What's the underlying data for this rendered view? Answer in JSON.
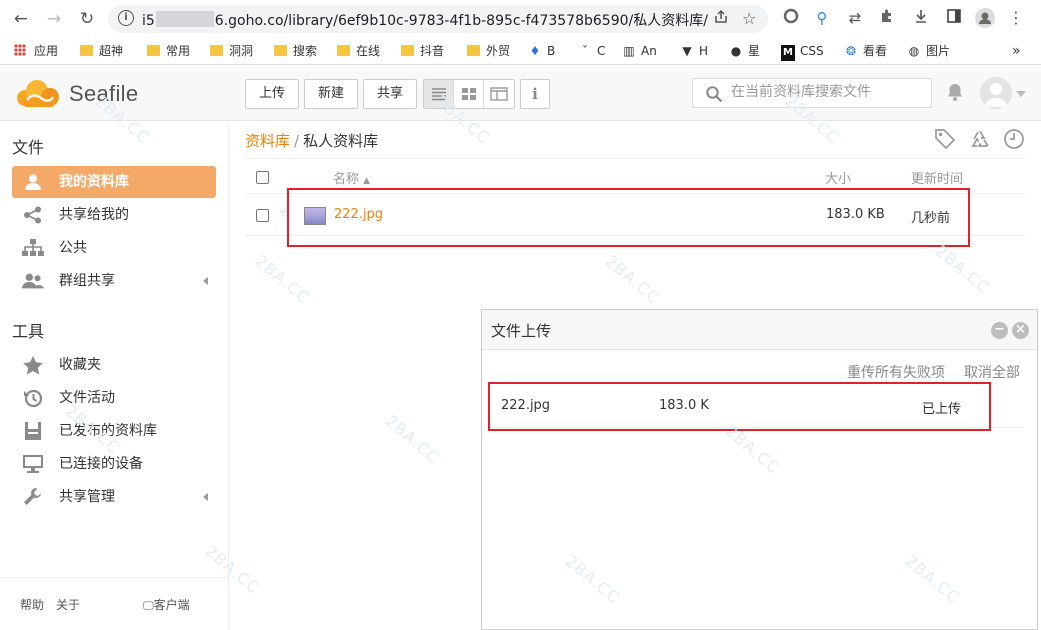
{
  "browser": {
    "url_prefix": "i5",
    "url_suffix": "6.goho.co/library/6ef9b10c-9783-4f1b-895c-f473578b6590/私人资料库/",
    "bookmarks": [
      {
        "label": "应用",
        "icon": "apps-grid"
      },
      {
        "label": "超神",
        "icon": "folder"
      },
      {
        "label": "常用",
        "icon": "folder"
      },
      {
        "label": "洞洞",
        "icon": "folder"
      },
      {
        "label": "搜索",
        "icon": "folder"
      },
      {
        "label": "在线",
        "icon": "folder"
      },
      {
        "label": "抖音",
        "icon": "folder"
      },
      {
        "label": "外贸",
        "icon": "folder"
      },
      {
        "label": "B",
        "icon": "flame-icon"
      },
      {
        "label": "C",
        "icon": "caron-icon"
      },
      {
        "label": "An",
        "icon": "book-icon"
      },
      {
        "label": "H",
        "icon": "cat-icon"
      },
      {
        "label": "星",
        "icon": "github-icon"
      },
      {
        "label": "CSS",
        "icon": "m-icon"
      },
      {
        "label": "看看",
        "icon": "swirl-icon"
      },
      {
        "label": "图片",
        "icon": "globe-icon"
      }
    ],
    "more": "»"
  },
  "header": {
    "logo_text": "Seafile",
    "buttons": {
      "upload": "上传",
      "new": "新建",
      "share": "共享"
    },
    "info": "i",
    "search_placeholder": "在当前资料库搜索文件"
  },
  "sidebar": {
    "files_title": "文件",
    "file_items": [
      {
        "label": "我的资料库",
        "icon": "user-icon",
        "active": true
      },
      {
        "label": "共享给我的",
        "icon": "share-icon"
      },
      {
        "label": "公共",
        "icon": "org-icon"
      },
      {
        "label": "群组共享",
        "icon": "group-icon",
        "arrow": true
      }
    ],
    "tools_title": "工具",
    "tool_items": [
      {
        "label": "收藏夹",
        "icon": "star-icon"
      },
      {
        "label": "文件活动",
        "icon": "history-icon"
      },
      {
        "label": "已发布的资料库",
        "icon": "publish-icon"
      },
      {
        "label": "已连接的设备",
        "icon": "monitor-icon"
      },
      {
        "label": "共享管理",
        "icon": "wrench-icon",
        "arrow": true
      }
    ],
    "footer": {
      "help": "帮助",
      "about": "关于",
      "client": "客户端"
    }
  },
  "breadcrumb": {
    "root": "资料库",
    "sep": "/",
    "current": "私人资料库"
  },
  "table": {
    "headers": {
      "name": "名称",
      "sort": "▲",
      "size": "大小",
      "updated": "更新时间"
    },
    "rows": [
      {
        "name": "222.jpg",
        "size": "183.0 KB",
        "updated": "几秒前"
      }
    ]
  },
  "upload_dialog": {
    "title": "文件上传",
    "retry_all": "重传所有失败项",
    "cancel_all": "取消全部",
    "items": [
      {
        "name": "222.jpg",
        "size": "183.0 K",
        "status": "已上传"
      }
    ]
  },
  "watermark": "2BA.CC",
  "colors": {
    "accent": "#eb8205",
    "active_bg": "#f5a968",
    "highlight": "#e0202a"
  }
}
